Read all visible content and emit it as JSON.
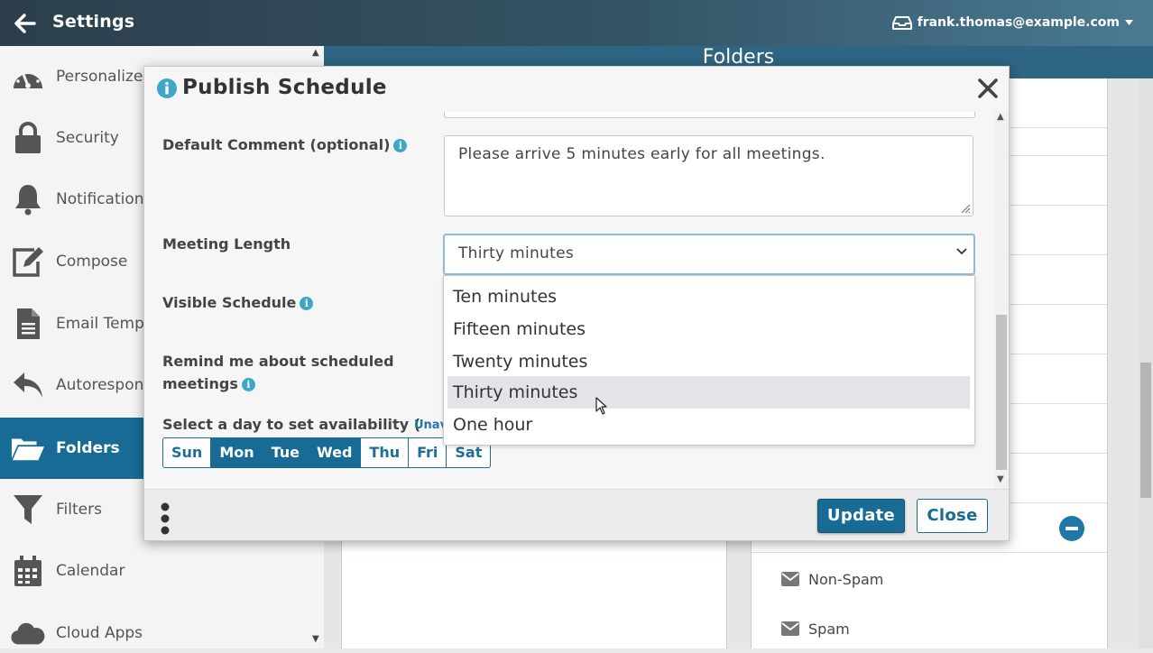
{
  "topbar": {
    "title": "Settings",
    "account": "frank.thomas@example.com"
  },
  "sidebar": {
    "items": [
      {
        "label": "Personalize",
        "icon": "gauge-icon"
      },
      {
        "label": "Security",
        "icon": "lock-icon"
      },
      {
        "label": "Notifications",
        "icon": "bell-icon"
      },
      {
        "label": "Compose",
        "icon": "edit-icon"
      },
      {
        "label": "Email Templates",
        "icon": "document-icon"
      },
      {
        "label": "Autoresponder",
        "icon": "reply-icon"
      },
      {
        "label": "Folders",
        "icon": "folder-open-icon",
        "active": true
      },
      {
        "label": "Filters",
        "icon": "filter-icon"
      },
      {
        "label": "Calendar",
        "icon": "calendar-icon"
      },
      {
        "label": "Cloud Apps",
        "icon": "cloud-icon"
      }
    ]
  },
  "main": {
    "header": "Folders",
    "folders": [
      {
        "label": "Non-Spam",
        "icon": "envelope-icon"
      },
      {
        "label": "Spam",
        "icon": "envelope-icon"
      }
    ]
  },
  "modal": {
    "title": "Publish Schedule",
    "fields": {
      "default_comment_label": "Default Comment (optional)",
      "default_comment_value": "Please arrive 5 minutes early for all meetings.",
      "meeting_length_label": "Meeting Length",
      "meeting_length_value": "Thirty minutes",
      "visible_schedule_label": "Visible Schedule",
      "remind_label_line1": "Remind me about scheduled",
      "remind_label_line2": "meetings",
      "select_day_label": "Select a day to set availability (",
      "unavailable_hint": "Unav"
    },
    "days": [
      {
        "label": "Sun",
        "on": false
      },
      {
        "label": "Mon",
        "on": true
      },
      {
        "label": "Tue",
        "on": true
      },
      {
        "label": "Wed",
        "on": true
      },
      {
        "label": "Thu",
        "on": false
      },
      {
        "label": "Fri",
        "on": false
      },
      {
        "label": "Sat",
        "on": false
      }
    ],
    "buttons": {
      "update": "Update",
      "close": "Close"
    }
  },
  "dropdown": {
    "options": [
      "Ten minutes",
      "Fifteen minutes",
      "Twenty minutes",
      "Thirty minutes",
      "One hour"
    ],
    "selected_index": 3
  },
  "colors": {
    "accent": "#176b95",
    "topbar": "#2c3e4b",
    "info": "#3fa7c6"
  }
}
